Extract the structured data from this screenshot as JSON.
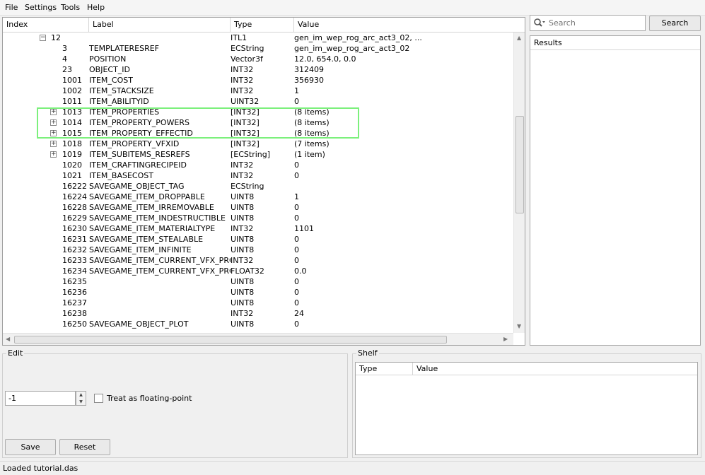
{
  "menu": {
    "file": "File",
    "settings": "Settings",
    "tools": "Tools",
    "help": "Help"
  },
  "tree": {
    "columns": {
      "index": "Index",
      "label": "Label",
      "type": "Type",
      "value": "Value"
    },
    "rows": [
      {
        "expander": "minus",
        "level": 1,
        "index": "12",
        "label": "",
        "type": "ITL1",
        "value": "gen_im_wep_rog_arc_act3_02, ..."
      },
      {
        "expander": null,
        "level": 2,
        "index": "3",
        "label": "TEMPLATERESREF",
        "type": "ECString",
        "value": "gen_im_wep_rog_arc_act3_02"
      },
      {
        "expander": null,
        "level": 2,
        "index": "4",
        "label": "POSITION",
        "type": "Vector3f",
        "value": "12.0, 654.0, 0.0"
      },
      {
        "expander": null,
        "level": 2,
        "index": "23",
        "label": "OBJECT_ID",
        "type": "INT32",
        "value": "312409"
      },
      {
        "expander": null,
        "level": 2,
        "index": "1001",
        "label": "ITEM_COST",
        "type": "INT32",
        "value": "356930"
      },
      {
        "expander": null,
        "level": 2,
        "index": "1002",
        "label": "ITEM_STACKSIZE",
        "type": "INT32",
        "value": "1"
      },
      {
        "expander": null,
        "level": 2,
        "index": "1011",
        "label": "ITEM_ABILITYID",
        "type": "UINT32",
        "value": "0"
      },
      {
        "expander": "plus",
        "level": 2,
        "index": "1013",
        "label": "ITEM_PROPERTIES",
        "type": "[INT32]",
        "value": "(8 items)"
      },
      {
        "expander": "plus",
        "level": 2,
        "index": "1014",
        "label": "ITEM_PROPERTY_POWERS",
        "type": "[INT32]",
        "value": "(8 items)"
      },
      {
        "expander": "plus",
        "level": 2,
        "index": "1015",
        "label": "ITEM_PROPERTY_EFFECTID",
        "type": "[INT32]",
        "value": "(8 items)"
      },
      {
        "expander": "plus",
        "level": 2,
        "index": "1018",
        "label": "ITEM_PROPERTY_VFXID",
        "type": "[INT32]",
        "value": "(7 items)"
      },
      {
        "expander": "plus",
        "level": 2,
        "index": "1019",
        "label": "ITEM_SUBITEMS_RESREFS",
        "type": "[ECString]",
        "value": "(1 item)"
      },
      {
        "expander": null,
        "level": 2,
        "index": "1020",
        "label": "ITEM_CRAFTINGRECIPEID",
        "type": "INT32",
        "value": "0"
      },
      {
        "expander": null,
        "level": 2,
        "index": "1021",
        "label": "ITEM_BASECOST",
        "type": "INT32",
        "value": "0"
      },
      {
        "expander": null,
        "level": 2,
        "index": "16222",
        "label": "SAVEGAME_OBJECT_TAG",
        "type": "ECString",
        "value": ""
      },
      {
        "expander": null,
        "level": 2,
        "index": "16224",
        "label": "SAVEGAME_ITEM_DROPPABLE",
        "type": "UINT8",
        "value": "1"
      },
      {
        "expander": null,
        "level": 2,
        "index": "16228",
        "label": "SAVEGAME_ITEM_IRREMOVABLE",
        "type": "UINT8",
        "value": "0"
      },
      {
        "expander": null,
        "level": 2,
        "index": "16229",
        "label": "SAVEGAME_ITEM_INDESTRUCTIBLE",
        "type": "UINT8",
        "value": "0"
      },
      {
        "expander": null,
        "level": 2,
        "index": "16230",
        "label": "SAVEGAME_ITEM_MATERIALTYPE",
        "type": "INT32",
        "value": "1101"
      },
      {
        "expander": null,
        "level": 2,
        "index": "16231",
        "label": "SAVEGAME_ITEM_STEALABLE",
        "type": "UINT8",
        "value": "0"
      },
      {
        "expander": null,
        "level": 2,
        "index": "16232",
        "label": "SAVEGAME_ITEM_INFINITE",
        "type": "UINT8",
        "value": "0"
      },
      {
        "expander": null,
        "level": 2,
        "index": "16233",
        "label": "SAVEGAME_ITEM_CURRENT_VFX_PROPE",
        "type": "INT32",
        "value": "0"
      },
      {
        "expander": null,
        "level": 2,
        "index": "16234",
        "label": "SAVEGAME_ITEM_CURRENT_VFX_PROPE",
        "type": "FLOAT32",
        "value": "0.0"
      },
      {
        "expander": null,
        "level": 2,
        "index": "16235",
        "label": "",
        "type": "UINT8",
        "value": "0"
      },
      {
        "expander": null,
        "level": 2,
        "index": "16236",
        "label": "",
        "type": "UINT8",
        "value": "0"
      },
      {
        "expander": null,
        "level": 2,
        "index": "16237",
        "label": "",
        "type": "UINT8",
        "value": "0"
      },
      {
        "expander": null,
        "level": 2,
        "index": "16238",
        "label": "",
        "type": "INT32",
        "value": "24"
      },
      {
        "expander": null,
        "level": 2,
        "index": "16250",
        "label": "SAVEGAME_OBJECT_PLOT",
        "type": "UINT8",
        "value": "0"
      }
    ]
  },
  "search": {
    "placeholder": "Search",
    "button_label": "Search"
  },
  "results": {
    "header": "Results"
  },
  "edit": {
    "title": "Edit",
    "value": "-1",
    "float_label": "Treat as floating-point",
    "float_checked": false,
    "save_label": "Save",
    "reset_label": "Reset"
  },
  "shelf": {
    "title": "Shelf",
    "col_type": "Type",
    "col_value": "Value"
  },
  "status": {
    "text": "Loaded tutorial.das"
  },
  "colors": {
    "highlight": "#7cf07c"
  },
  "icons": {
    "search": "search-icon",
    "expand": "plus-expander-icon",
    "collapse": "minus-expander-icon"
  }
}
